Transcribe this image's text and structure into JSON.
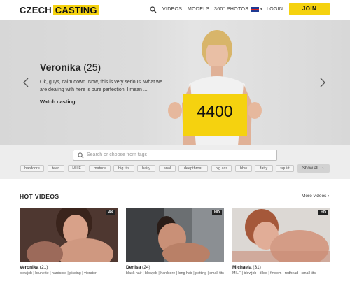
{
  "header": {
    "logo_part1": "CZECH",
    "logo_part2": "CASTING",
    "nav": [
      "VIDEOS",
      "MODELS",
      "360° PHOTOS"
    ],
    "login": "LOGIN",
    "join": "JOIN",
    "colors": {
      "accent": "#f5d20f"
    }
  },
  "hero": {
    "name": "Veronika",
    "age": "(25)",
    "description": "Ok, guys, calm down. Now, this is very serious. What we are dealing with here is pure perfection. I mean ...",
    "cta": "Watch casting",
    "sign_number": "4400"
  },
  "tags": {
    "search_placeholder": "Search or choose from tags",
    "items": [
      "hardcore",
      "teen",
      "MILF",
      "mature",
      "big tits",
      "hairy",
      "anal",
      "deepthroat",
      "big ass",
      "bbw",
      "fatty",
      "squirt"
    ],
    "show_all": "Show all"
  },
  "hot_videos": {
    "title": "HOT VIDEOS",
    "more": "More videos",
    "cards": [
      {
        "name": "Veronika",
        "age": "(21)",
        "badge": "4K",
        "tags": "blowjob | brunette | hardcore | pissing | vibrator"
      },
      {
        "name": "Denisa",
        "age": "(24)",
        "badge": "HD",
        "tags": "black hair | blowjob | hardcore | long hair | petting | small tits"
      },
      {
        "name": "Michaela",
        "age": "(31)",
        "badge": "HD",
        "tags": "MILF | blowjob | dildo | fmdom | redhead | small tits"
      }
    ]
  }
}
